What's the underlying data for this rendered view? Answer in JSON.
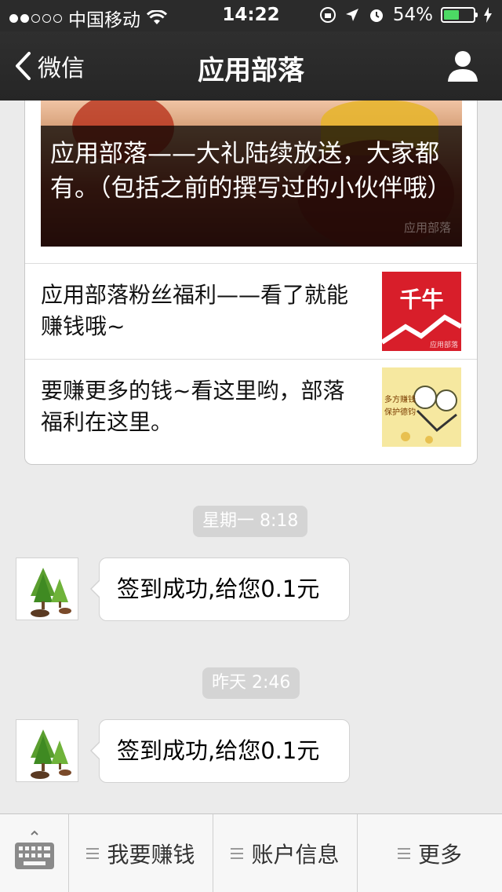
{
  "status_bar": {
    "carrier": "中国移动",
    "time": "14:22",
    "battery": "54%",
    "battery_level": 0.54
  },
  "nav": {
    "back_label": "微信",
    "title": "应用部落",
    "profile_icon": "person-icon"
  },
  "article_card": {
    "cover_title": "应用部落——大礼陆续放送，大家都有。（包括之前的撰写过的小伙伴哦）",
    "cover_watermark": "应用部落",
    "items": [
      {
        "title": "应用部落粉丝福利——看了就能赚钱哦~",
        "thumb_text": "千牛",
        "thumb_watermark": "应用部落"
      },
      {
        "title": "要赚更多的钱~看这里哟，部落福利在这里。",
        "thumb_text": "多方赚钱\n保护德钧"
      }
    ]
  },
  "messages": [
    {
      "timestamp": "星期一 8:18",
      "text": "签到成功,给您0.1元",
      "avatar_icon": "tree-avatar-icon"
    },
    {
      "timestamp": "昨天 2:46",
      "text": "签到成功,给您0.1元",
      "avatar_icon": "tree-avatar-icon"
    }
  ],
  "bottom_menu": {
    "keyboard_icon": "keyboard-icon",
    "items": [
      "我要赚钱",
      "账户信息",
      "更多"
    ]
  },
  "colors": {
    "nav_bg": "#2b2b2b",
    "page_bg": "#ebebeb",
    "battery_green": "#4cd964",
    "thumb_red": "#d81e2a"
  }
}
